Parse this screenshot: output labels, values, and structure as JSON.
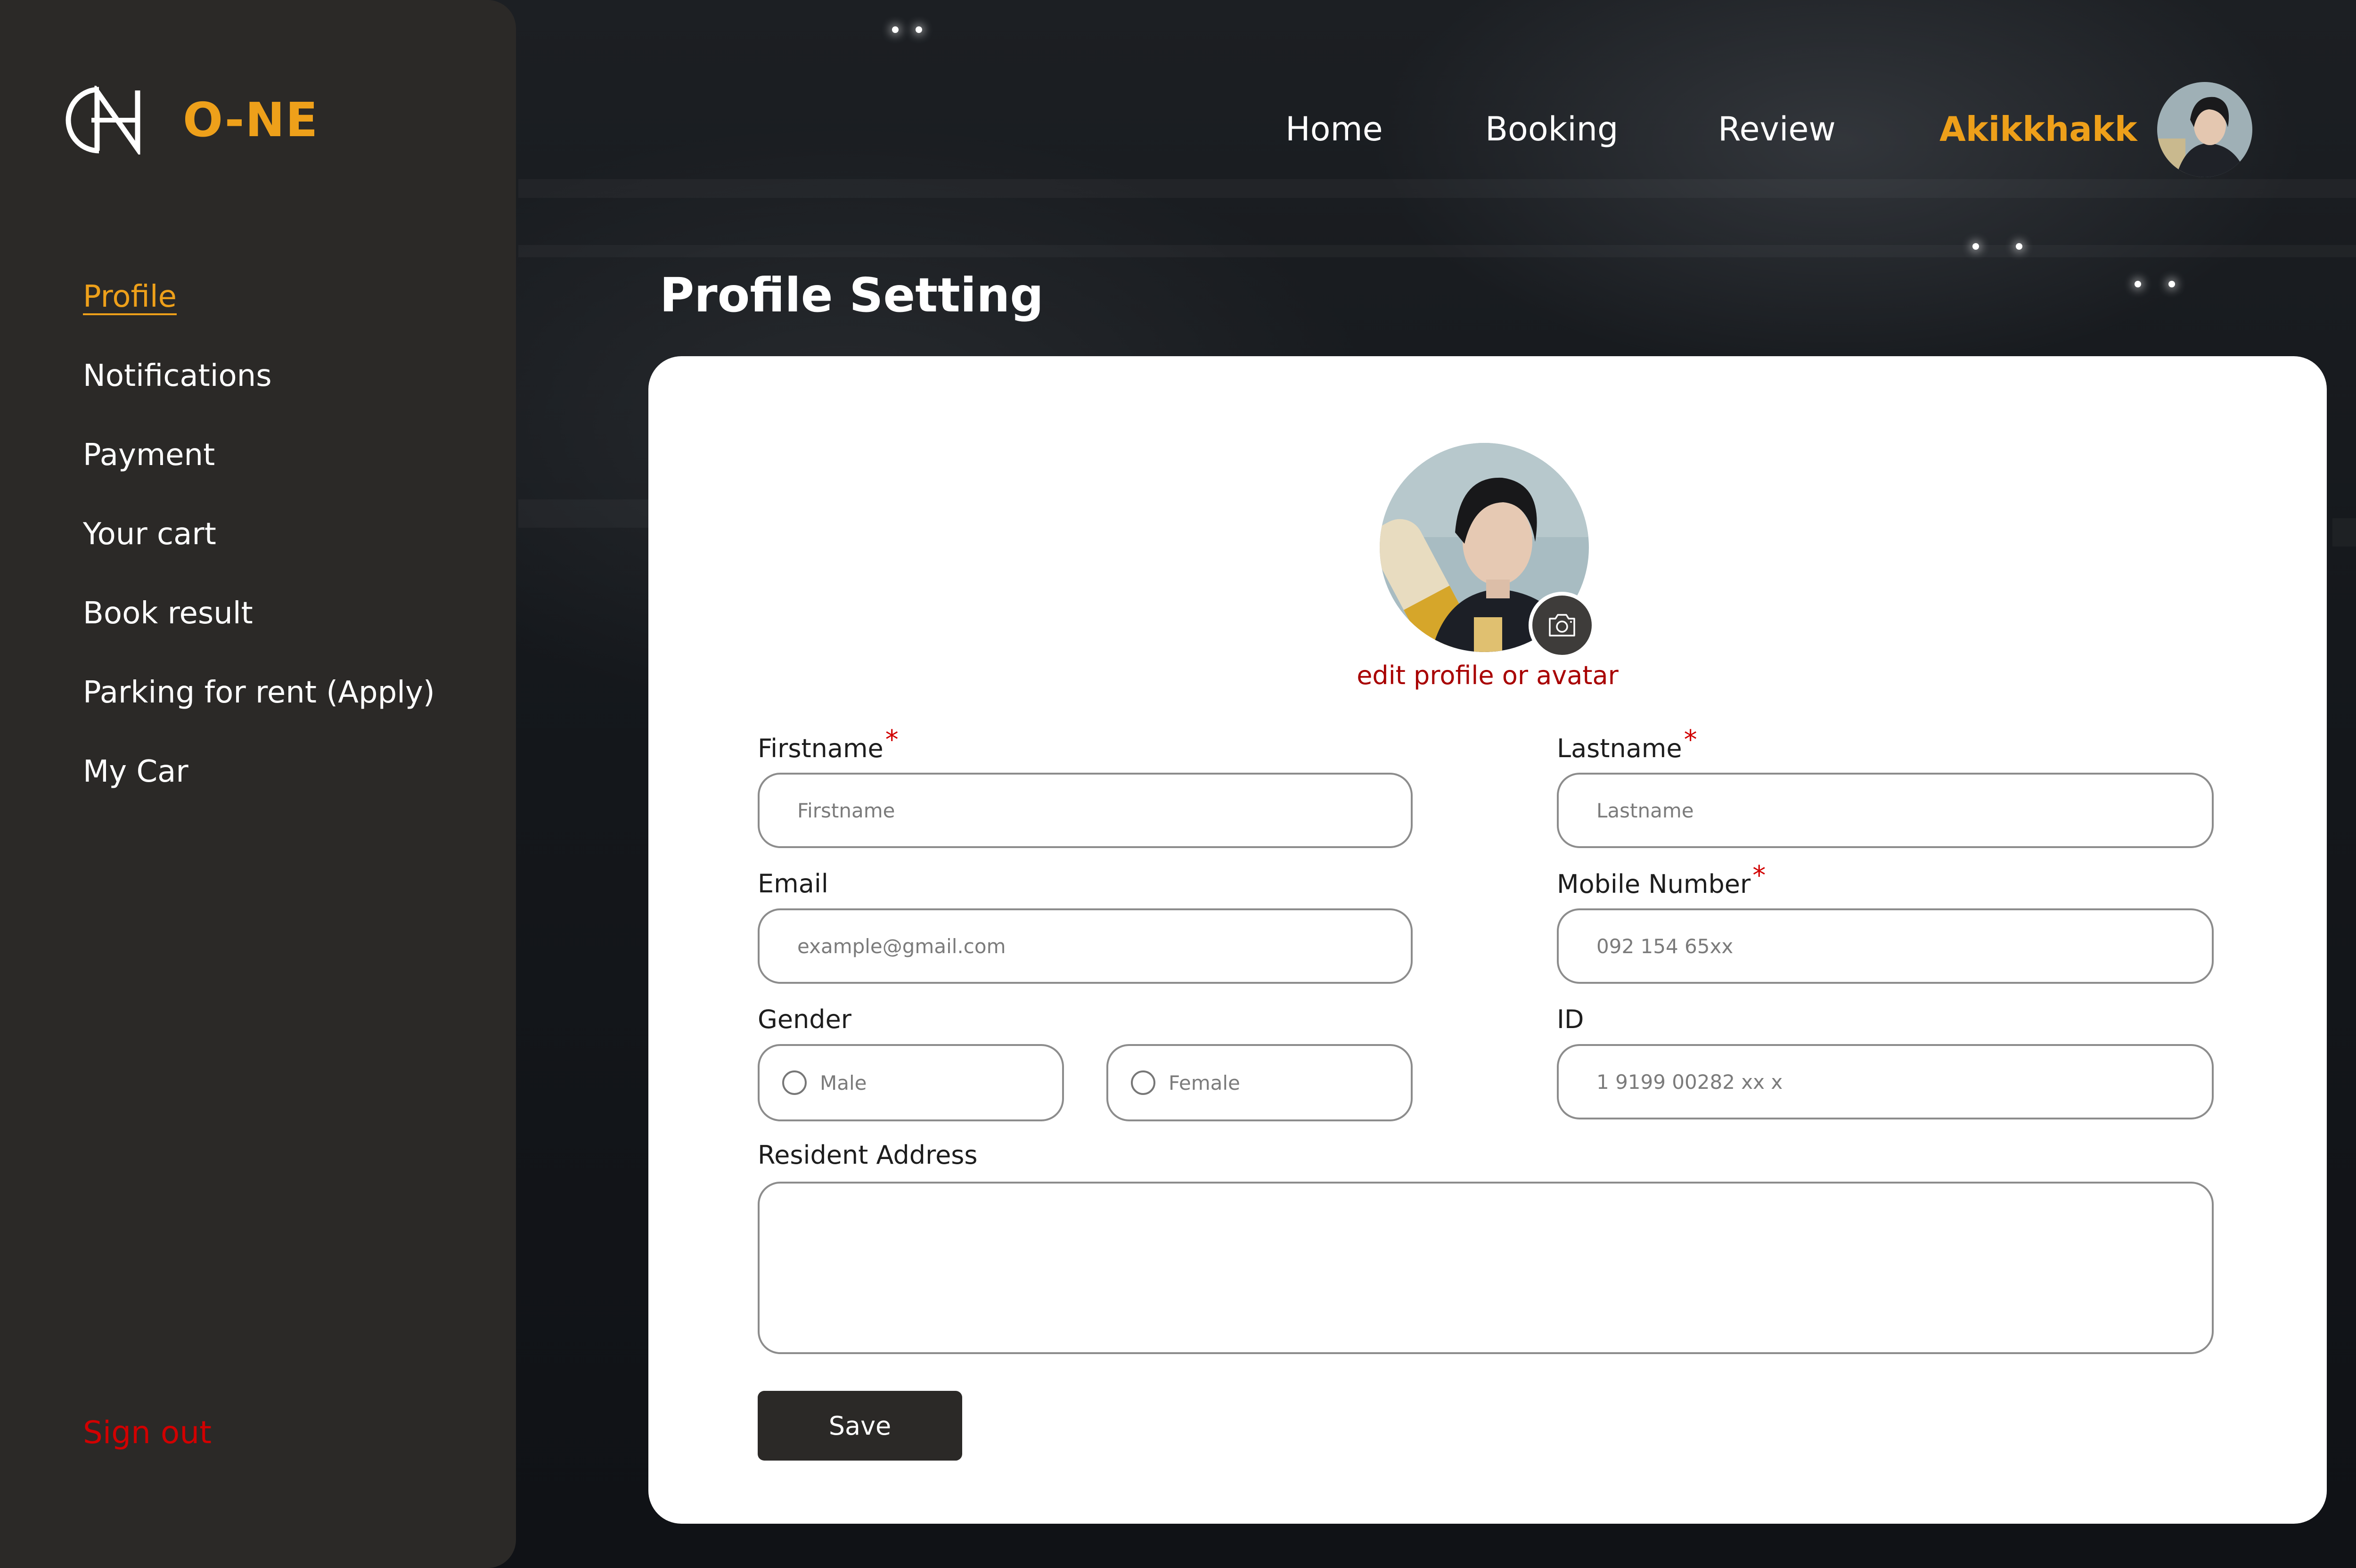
{
  "brand": {
    "name": "O-NE"
  },
  "sidebar": {
    "items": [
      {
        "label": "Profile",
        "active": true
      },
      {
        "label": "Notifications"
      },
      {
        "label": "Payment"
      },
      {
        "label": "Your cart"
      },
      {
        "label": "Book result"
      },
      {
        "label": "Parking for rent (Apply)"
      },
      {
        "label": "My Car"
      }
    ],
    "signout_label": "Sign out"
  },
  "header": {
    "nav": [
      "Home",
      "Booking",
      "Review"
    ],
    "user_name": "Akikkhakk"
  },
  "page": {
    "title": "Profile Setting"
  },
  "profile": {
    "edit_avatar_label": "edit profile or avatar",
    "firstname": {
      "label": "Firstname",
      "required_mark": "*",
      "placeholder": "Firstname",
      "value": ""
    },
    "lastname": {
      "label": "Lastname",
      "required_mark": "*",
      "placeholder": "Lastname",
      "value": ""
    },
    "email": {
      "label": "Email",
      "placeholder": "example@gmail.com",
      "value": ""
    },
    "mobile": {
      "label": "Mobile Number",
      "required_mark": "*",
      "placeholder": "092 154 65xx",
      "value": ""
    },
    "gender": {
      "label": "Gender",
      "options": [
        "Male",
        "Female"
      ]
    },
    "id": {
      "label": "ID",
      "placeholder": "1 9199 00282 xx x",
      "value": ""
    },
    "address": {
      "label": "Resident Address",
      "value": ""
    },
    "save_label": "Save"
  },
  "colors": {
    "accent": "#eea01a",
    "danger": "#d10000",
    "sidebar_bg": "#2b2927",
    "button_bg": "#2b2927"
  },
  "icons": {
    "camera": "camera-icon",
    "logo": "brand-logo-icon"
  }
}
